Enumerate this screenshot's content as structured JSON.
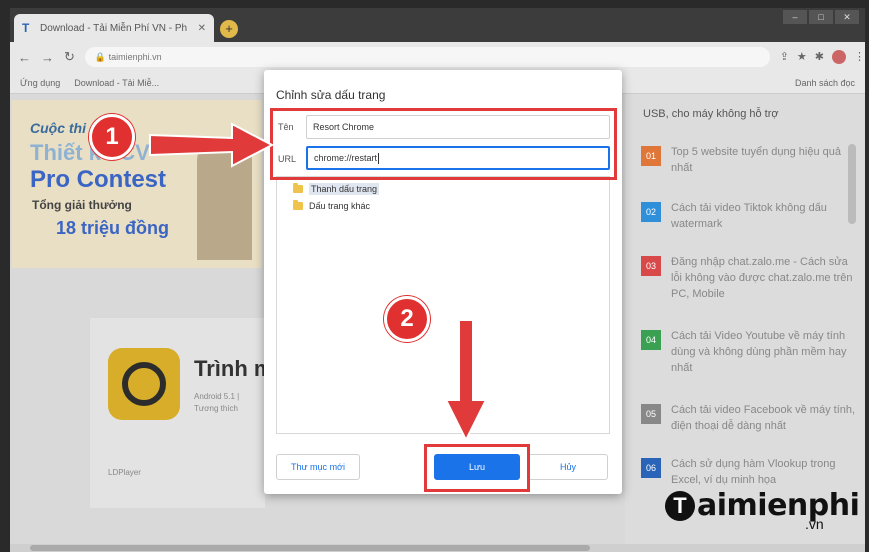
{
  "browser": {
    "tab_title": "Download - Tải Miễn Phí VN - Ph",
    "tab_favicon": "T",
    "url": "taimienphi.vn",
    "bookmarks": [
      "Ứng dụng",
      "Download - Tải Miễ..."
    ],
    "bookmarks_right": "Danh sách đọc"
  },
  "page": {
    "banner": {
      "line1": "Cuộc thi",
      "line2": "Thiết kế CV",
      "line3": "Pro Contest",
      "line4": "Tổng giải thưởng",
      "line5": "18 triệu đồng"
    },
    "app": {
      "title": "Trình m",
      "line1": "Android 5.1 |",
      "line2": "Tương thích",
      "footer": "LDPlayer"
    },
    "sidebar": {
      "heading": "USB, cho máy không hỗ trợ",
      "items": [
        {
          "num": "01",
          "color": "#e0773a",
          "text": "Top 5 website tuyển dụng hiệu quả nhất"
        },
        {
          "num": "02",
          "color": "#2f8fd8",
          "text": "Cách tải video Tiktok không dấu watermark"
        },
        {
          "num": "03",
          "color": "#d84a4a",
          "text": "Đăng nhập chat.zalo.me - Cách sửa lỗi không vào được chat.zalo.me trên PC, Mobile"
        },
        {
          "num": "04",
          "color": "#3aa052",
          "text": "Cách tải Video Youtube về máy tính dùng và không dùng phần mềm hay nhất"
        },
        {
          "num": "05",
          "color": "#888888",
          "text": "Cách tải video Facebook về máy tính, điện thoại dễ dàng nhất"
        },
        {
          "num": "06",
          "color": "#2a64b8",
          "text": "Cách sử dụng hàm Vlookup trong Excel, ví dụ minh họa"
        }
      ]
    }
  },
  "dialog": {
    "title": "Chỉnh sửa dấu trang",
    "name_label": "Tên",
    "name_value": "Resort Chrome",
    "url_label": "URL",
    "url_value": "chrome://restart",
    "folders": [
      "Thanh dấu trang",
      "Dấu trang khác"
    ],
    "new_folder_button": "Thư mục mới",
    "save_button": "Lưu",
    "cancel_button": "Hủy"
  },
  "annotations": {
    "step1": "1",
    "step2": "2",
    "color": "#e03a3a"
  },
  "watermark": {
    "logo_letter": "T",
    "logo_text": "aimienphi",
    "logo_suffix": ".vn"
  }
}
